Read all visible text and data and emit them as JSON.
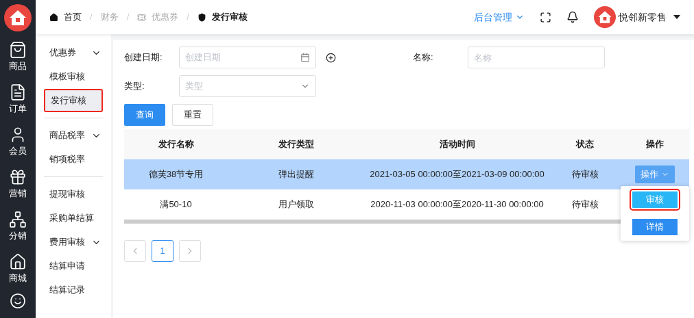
{
  "nav_rail": [
    {
      "kind": "bag",
      "label": "商品"
    },
    {
      "kind": "doc",
      "label": "订单"
    },
    {
      "kind": "user",
      "label": "会员"
    },
    {
      "kind": "gift",
      "label": "营销"
    },
    {
      "kind": "network",
      "label": "分销"
    },
    {
      "kind": "house",
      "label": "商城"
    }
  ],
  "breadcrumb": [
    {
      "kind": "home",
      "label": "首页",
      "current": false,
      "muted": false
    },
    {
      "kind": "none",
      "label": "财务",
      "current": false,
      "muted": true
    },
    {
      "kind": "coupon",
      "label": "优惠券",
      "current": false,
      "muted": true
    },
    {
      "kind": "shield",
      "label": "发行审核",
      "current": true,
      "muted": false
    }
  ],
  "header": {
    "breadcrumb_separator": "/",
    "system_menu": "后台管理",
    "user_name": "悦邻新零售"
  },
  "submenu": [
    {
      "kind": "group",
      "label": "优惠券",
      "expanded": true
    },
    {
      "kind": "item",
      "label": "模板审核",
      "selected": false
    },
    {
      "kind": "item",
      "label": "发行审核",
      "selected": true
    },
    {
      "kind": "divider"
    },
    {
      "kind": "group",
      "label": "商品税率",
      "expanded": true
    },
    {
      "kind": "item",
      "label": "销项税率",
      "selected": false
    },
    {
      "kind": "divider"
    },
    {
      "kind": "item",
      "label": "提现审核",
      "selected": false
    },
    {
      "kind": "item",
      "label": "采购单结算",
      "selected": false
    },
    {
      "kind": "group",
      "label": "费用审核",
      "expanded": true
    },
    {
      "kind": "item",
      "label": "结算申请",
      "selected": false
    },
    {
      "kind": "item",
      "label": "结算记录",
      "selected": false
    }
  ],
  "filters": {
    "date_label": "创建日期:",
    "date_placeholder": "创建日期",
    "name_label": "名称:",
    "name_placeholder": "名称",
    "type_label": "类型:",
    "type_placeholder": "类型",
    "query_button": "查询",
    "reset_button": "重置"
  },
  "table": {
    "columns": [
      "发行名称",
      "发行类型",
      "活动时间",
      "状态",
      "操作"
    ],
    "rows": [
      {
        "cells": [
          "德芙38节专用",
          "弹出提醒",
          "2021-03-05 00:00:00至2021-03-09 00:00:00",
          "待审核"
        ],
        "action": "操作",
        "selected": true
      },
      {
        "cells": [
          "满50-10",
          "用户领取",
          "2020-11-03 00:00:00至2020-11-30 00:00:00",
          "待审核"
        ],
        "action": "",
        "selected": false
      }
    ]
  },
  "action_menu": [
    {
      "label": "审核",
      "highlighted": true
    },
    {
      "label": "详情",
      "highlighted": false
    }
  ],
  "pagination": {
    "pages": [
      {
        "label": "1",
        "selected": true
      }
    ]
  }
}
